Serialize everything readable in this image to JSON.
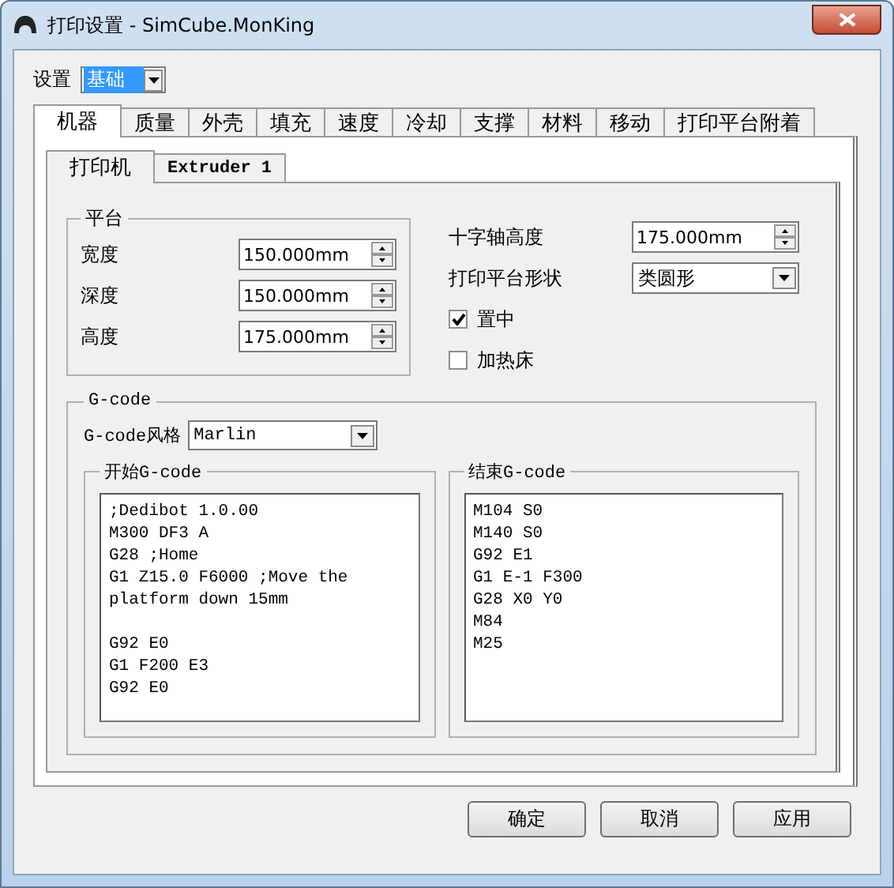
{
  "window": {
    "title": "打印设置 - SimCube.MonKing"
  },
  "settings": {
    "label": "设置",
    "value": "基础"
  },
  "tabs": [
    {
      "label": "机器",
      "selected": true
    },
    {
      "label": "质量",
      "selected": false
    },
    {
      "label": "外壳",
      "selected": false
    },
    {
      "label": "填充",
      "selected": false
    },
    {
      "label": "速度",
      "selected": false
    },
    {
      "label": "冷却",
      "selected": false
    },
    {
      "label": "支撑",
      "selected": false
    },
    {
      "label": "材料",
      "selected": false
    },
    {
      "label": "移动",
      "selected": false
    },
    {
      "label": "打印平台附着",
      "selected": false
    }
  ],
  "sub_tabs": [
    {
      "label": "打印机",
      "selected": true
    },
    {
      "label": "Extruder 1",
      "selected": false
    }
  ],
  "platform": {
    "title": "平台",
    "fields": [
      {
        "label": "宽度",
        "value": "150.000mm"
      },
      {
        "label": "深度",
        "value": "150.000mm"
      },
      {
        "label": "高度",
        "value": "175.000mm"
      }
    ]
  },
  "right_fields": [
    {
      "kind": "spin",
      "label": "十字轴高度",
      "value": "175.000mm"
    },
    {
      "kind": "dropdown",
      "label": "打印平台形状",
      "value": "类圆形"
    }
  ],
  "checkboxes": [
    {
      "label": "置中",
      "checked": true
    },
    {
      "label": "加热床",
      "checked": false
    }
  ],
  "gcode": {
    "title": "G-code",
    "style_label": "G-code风格",
    "style_value": "Marlin",
    "start": {
      "title": "开始G-code",
      "value": ";Dedibot 1.0.00\nM300 DF3 A\nG28 ;Home\nG1 Z15.0 F6000 ;Move the platform down 15mm\n\nG92 E0\nG1 F200 E3\nG92 E0"
    },
    "end": {
      "title": "结束G-code",
      "value": "M104 S0\nM140 S0\nG92 E1\nG1 E-1 F300\nG28 X0 Y0\nM84\nM25"
    }
  },
  "buttons": [
    "确定",
    "取消",
    "应用"
  ]
}
